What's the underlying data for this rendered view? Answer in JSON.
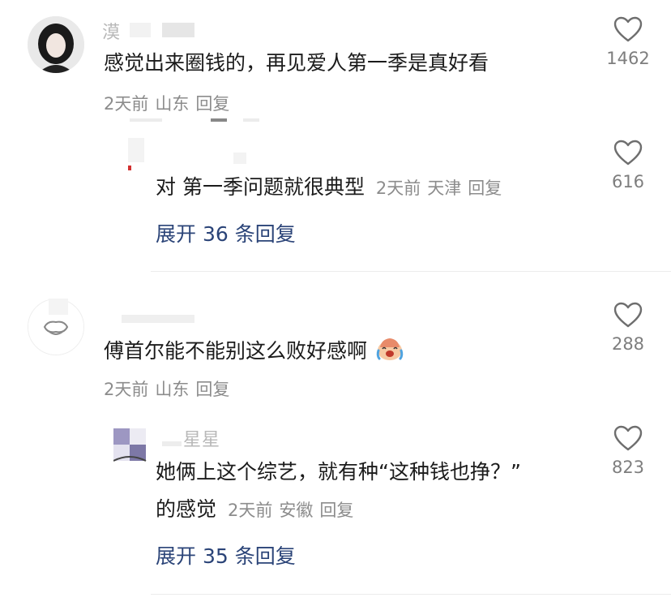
{
  "comments": [
    {
      "username": "漠",
      "text": "感觉出来圈钱的，再见爱人第一季是真好看",
      "date": "2天前",
      "location": "山东",
      "reply_label": "回复",
      "likes": "1462",
      "reply": {
        "username": "",
        "text": "对 第一季问题就很典型",
        "date": "2天前",
        "location": "天津",
        "reply_label": "回复",
        "likes": "616",
        "expand_label": "展开 36 条回复"
      }
    },
    {
      "username": "",
      "text": "傅首尔能不能别这么败好感啊",
      "date": "2天前",
      "location": "山东",
      "reply_label": "回复",
      "likes": "288",
      "reply": {
        "username": "星星",
        "text_line1": "她俩上这个综艺，就有种“这种钱也挣？”",
        "text_line2": "的感觉",
        "date": "2天前",
        "location": "安徽",
        "reply_label": "回复",
        "likes": "823",
        "expand_label": "展开 35 条回复"
      }
    }
  ]
}
